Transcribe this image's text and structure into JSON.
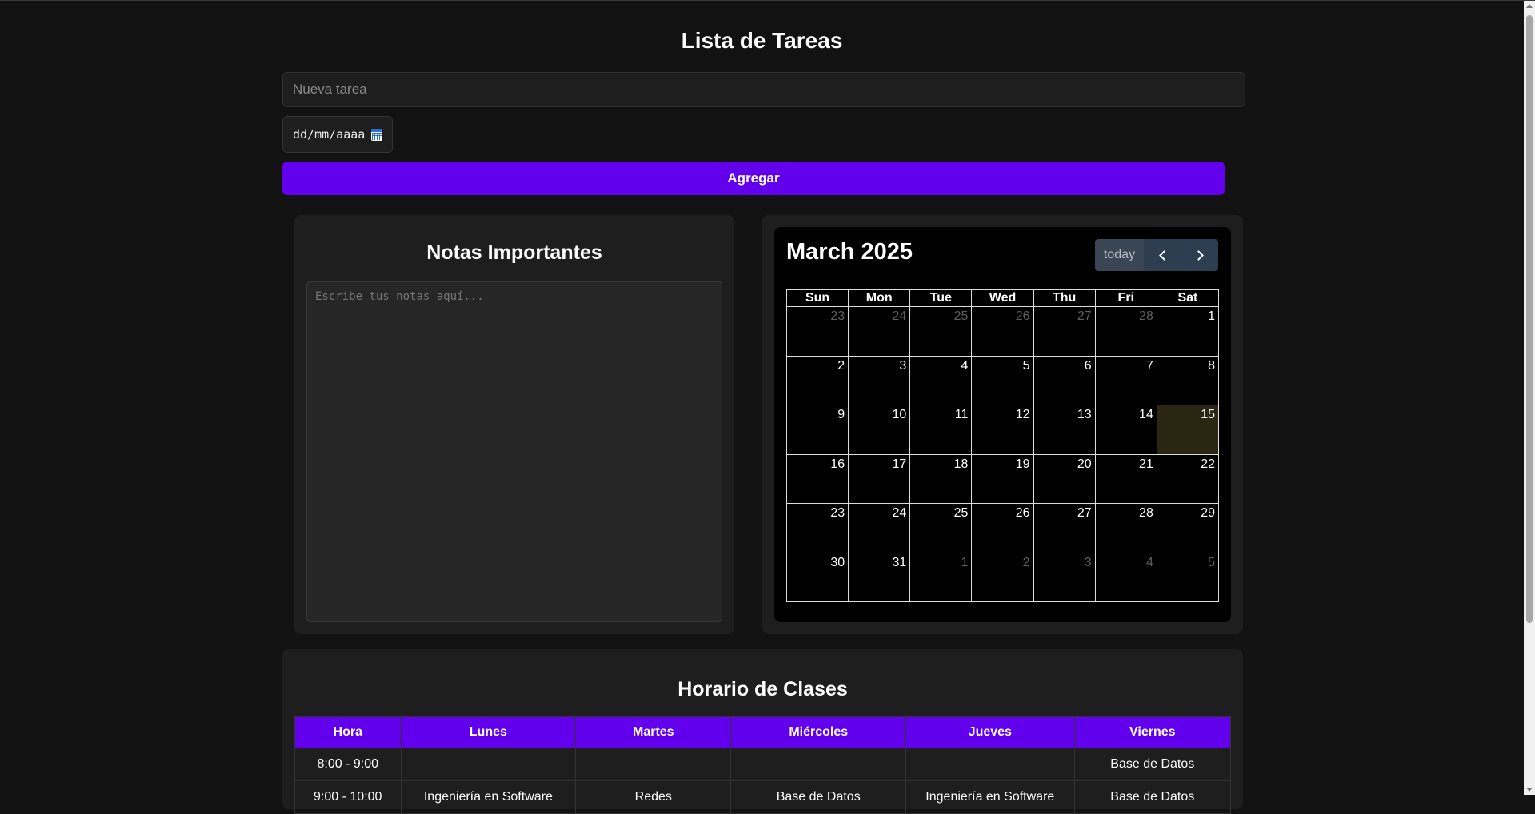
{
  "todo": {
    "title": "Lista de Tareas",
    "task_placeholder": "Nueva tarea",
    "date_placeholder": "dd/mm/aaaa",
    "add_label": "Agregar"
  },
  "notes": {
    "title": "Notas Importantes",
    "placeholder": "Escribe tus notas aquí..."
  },
  "calendar": {
    "title": "March 2025",
    "today_label": "today",
    "weekdays": [
      "Sun",
      "Mon",
      "Tue",
      "Wed",
      "Thu",
      "Fri",
      "Sat"
    ],
    "weeks": [
      [
        {
          "d": "23",
          "o": true
        },
        {
          "d": "24",
          "o": true
        },
        {
          "d": "25",
          "o": true
        },
        {
          "d": "26",
          "o": true
        },
        {
          "d": "27",
          "o": true
        },
        {
          "d": "28",
          "o": true
        },
        {
          "d": "1"
        }
      ],
      [
        {
          "d": "2"
        },
        {
          "d": "3"
        },
        {
          "d": "4"
        },
        {
          "d": "5"
        },
        {
          "d": "6"
        },
        {
          "d": "7"
        },
        {
          "d": "8"
        }
      ],
      [
        {
          "d": "9"
        },
        {
          "d": "10"
        },
        {
          "d": "11"
        },
        {
          "d": "12"
        },
        {
          "d": "13"
        },
        {
          "d": "14"
        },
        {
          "d": "15",
          "today": true
        }
      ],
      [
        {
          "d": "16"
        },
        {
          "d": "17"
        },
        {
          "d": "18"
        },
        {
          "d": "19"
        },
        {
          "d": "20"
        },
        {
          "d": "21"
        },
        {
          "d": "22"
        }
      ],
      [
        {
          "d": "23"
        },
        {
          "d": "24"
        },
        {
          "d": "25"
        },
        {
          "d": "26"
        },
        {
          "d": "27"
        },
        {
          "d": "28"
        },
        {
          "d": "29"
        }
      ],
      [
        {
          "d": "30"
        },
        {
          "d": "31"
        },
        {
          "d": "1",
          "o": true
        },
        {
          "d": "2",
          "o": true
        },
        {
          "d": "3",
          "o": true
        },
        {
          "d": "4",
          "o": true
        },
        {
          "d": "5",
          "o": true
        }
      ]
    ]
  },
  "schedule": {
    "title": "Horario de Clases",
    "headers": [
      "Hora",
      "Lunes",
      "Martes",
      "Miércoles",
      "Jueves",
      "Viernes"
    ],
    "rows": [
      [
        "8:00 - 9:00",
        "",
        "",
        "",
        "",
        "Base de Datos"
      ],
      [
        "9:00 - 10:00",
        "Ingeniería en Software",
        "Redes",
        "Base de Datos",
        "Ingeniería en Software",
        "Base de Datos"
      ]
    ]
  },
  "colors": {
    "accent": "#6200ee",
    "background": "#121212",
    "panel": "#1e1e1e",
    "today_highlight": "#2a2612"
  },
  "icons": {
    "date_picker": "calendar-icon",
    "prev": "chevron-left-icon",
    "next": "chevron-right-icon"
  }
}
